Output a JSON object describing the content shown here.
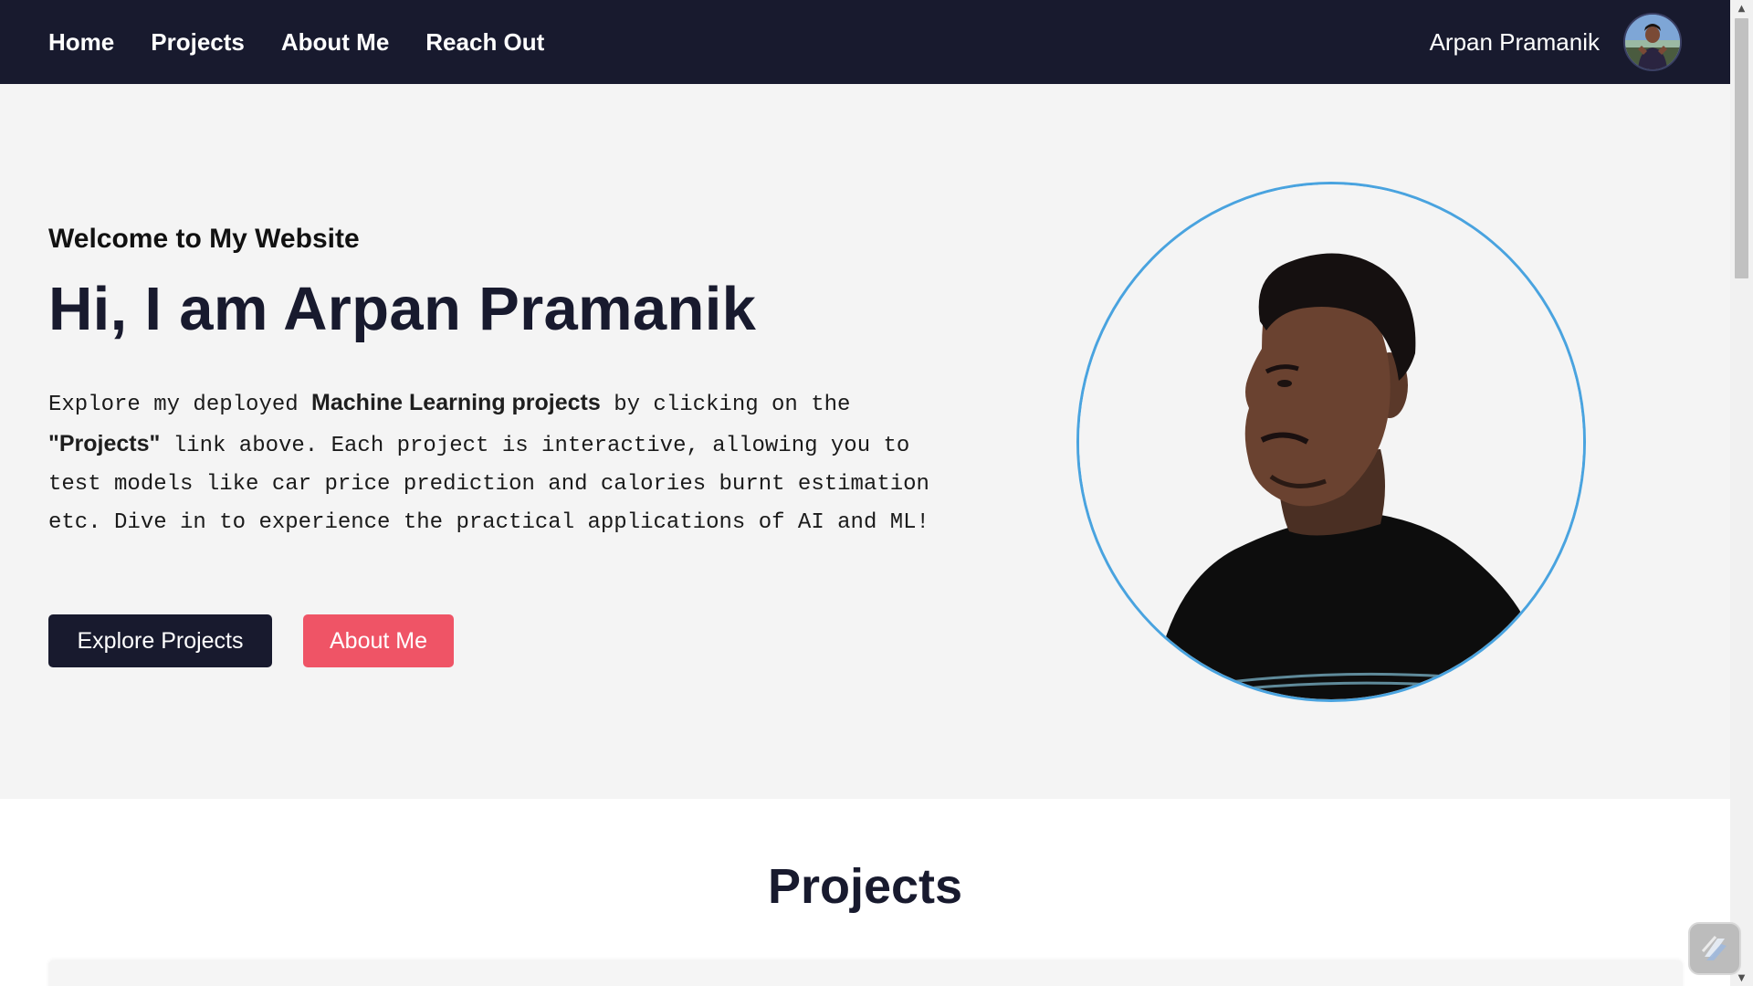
{
  "nav": {
    "links": [
      {
        "label": "Home"
      },
      {
        "label": "Projects"
      },
      {
        "label": "About Me"
      },
      {
        "label": "Reach Out"
      }
    ],
    "user_name": "Arpan Pramanik"
  },
  "hero": {
    "subtitle": "Welcome to My Website",
    "title": "Hi, I am Arpan Pramanik",
    "desc": {
      "part1": "Explore my deployed ",
      "strong1": "Machine Learning projects",
      "part2": " by clicking on the ",
      "strong2": "\"Projects\"",
      "part3": " link above. Each project is interactive, allowing you to test models like car price prediction and calories burnt estimation etc. Dive in to experience the practical applications of AI and ML!"
    },
    "buttons": {
      "explore": "Explore Projects",
      "about": "About Me"
    }
  },
  "projects": {
    "heading": "Projects"
  },
  "colors": {
    "nav_bg": "#181a2e",
    "hero_bg": "#f4f4f4",
    "accent_red": "#ef5466",
    "portrait_ring": "#49a3df"
  },
  "icons": {
    "avatar": "user-avatar-photo",
    "portrait": "profile-portrait-photo",
    "widget": "lightning-widget-icon"
  }
}
